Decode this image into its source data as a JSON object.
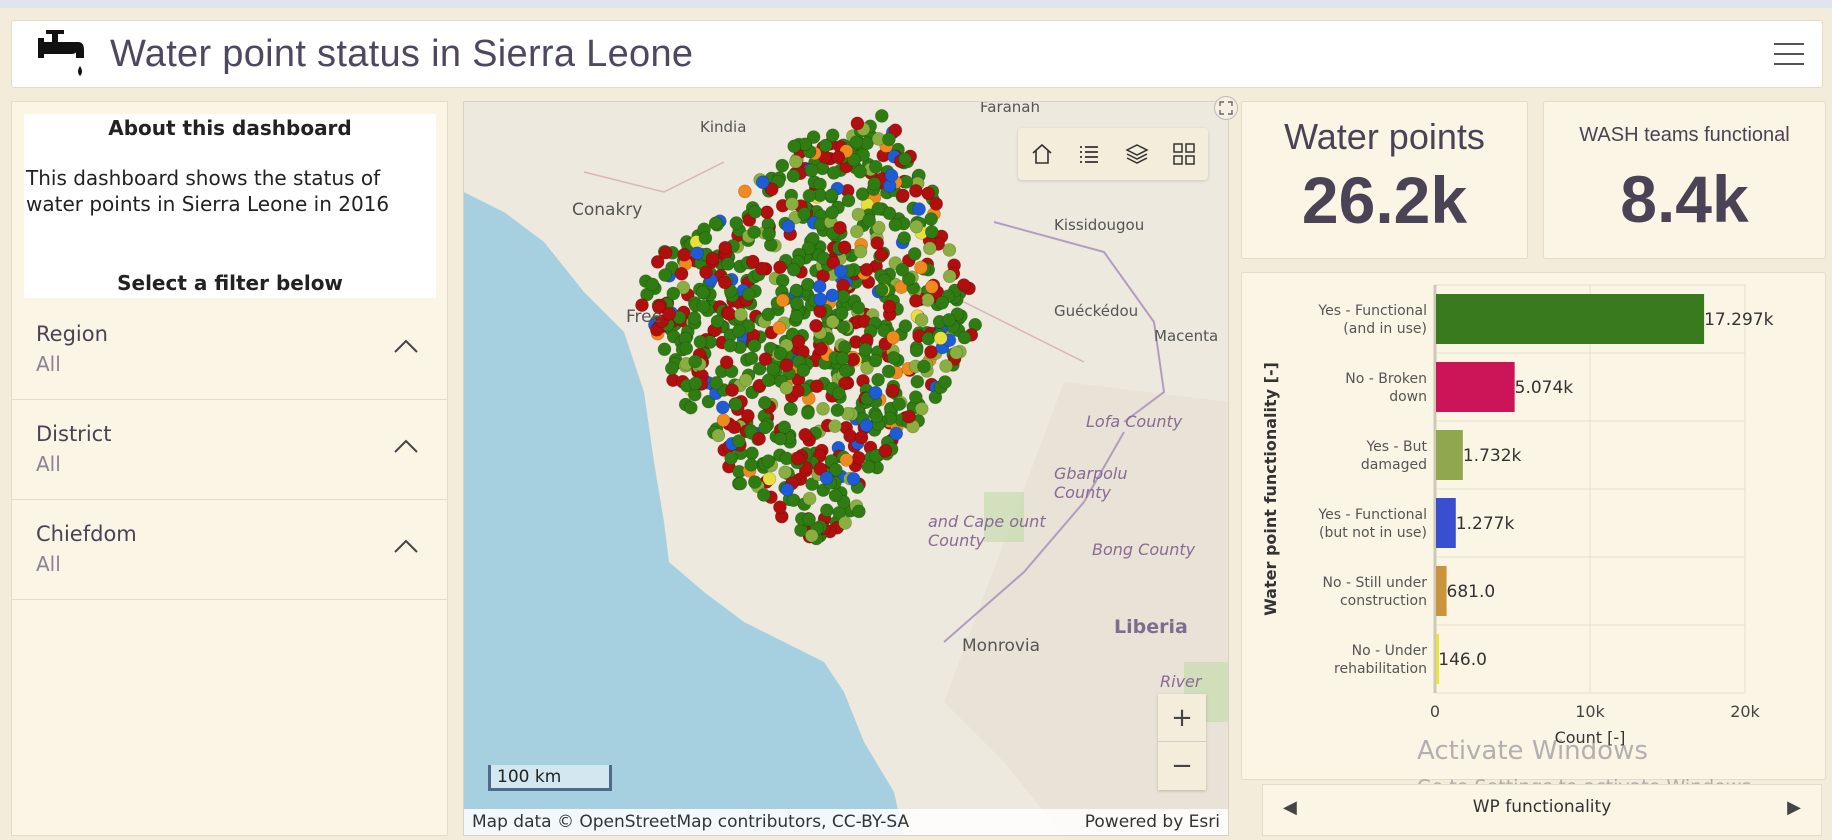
{
  "header": {
    "title": "Water point status in Sierra Leone"
  },
  "about": {
    "heading": "About this dashboard",
    "text": "This dashboard shows the status of water points in Sierra Leone in 2016",
    "filter_prompt": "Select a filter below"
  },
  "filters": [
    {
      "label": "Region",
      "value": "All"
    },
    {
      "label": "District",
      "value": "All"
    },
    {
      "label": "Chiefdom",
      "value": "All"
    }
  ],
  "map": {
    "labels": {
      "kindia": "Kindia",
      "faranah": "Faranah",
      "conakry": "Conakry",
      "kissidougou": "Kissidougou",
      "freetown": "Free",
      "gueckedou": "Guéckédou",
      "macenta": "Macenta",
      "lofa": "Lofa County",
      "gbarpolu": "Gbarpolu County",
      "grandcape": "and Cape ount County",
      "bong": "Bong County",
      "monrovia": "Monrovia",
      "liberia": "Liberia",
      "rivercess": "River Cess"
    },
    "scale_label": "100 km",
    "attribution": "Map data © OpenStreetMap contributors, CC-BY-SA",
    "powered_by": "Powered by Esri",
    "zoom_in": "+",
    "zoom_out": "−",
    "point_colors": [
      "#2f7d12",
      "#b10e0e",
      "#8aae3f",
      "#1e5bd6",
      "#f08a1c",
      "#e8e03a"
    ]
  },
  "kpis": {
    "water_points": {
      "title": "Water points",
      "value": "26.2k"
    },
    "wash_teams": {
      "title": "WASH teams functional",
      "value": "8.4k"
    }
  },
  "chart_data": {
    "type": "bar",
    "orientation": "horizontal",
    "categories": [
      [
        "Yes - Functional",
        "(and in use)"
      ],
      [
        "No - Broken",
        "down"
      ],
      [
        "Yes - But",
        "damaged"
      ],
      [
        "Yes - Functional",
        "(but not in use)"
      ],
      [
        "No - Still under",
        "construction"
      ],
      [
        "No - Under",
        "rehabilitation"
      ]
    ],
    "values": [
      17297,
      5074,
      1732,
      1277,
      681,
      146
    ],
    "value_labels": [
      "17.297k",
      "5.074k",
      "1.732k",
      "1.277k",
      "681.0",
      "146.0"
    ],
    "colors": [
      "#3a7a1e",
      "#cc1559",
      "#8fa84e",
      "#3a4fd0",
      "#c9943c",
      "#e8e43a"
    ],
    "xlim": [
      0,
      20000
    ],
    "xticks": [
      "0",
      "10k",
      "20k"
    ],
    "xlabel": "Count [-]",
    "ylabel": "Water point functionality [-]",
    "grid": true
  },
  "nav": {
    "label": "WP functionality",
    "prev": "◀",
    "next": "▶"
  },
  "watermark": {
    "line1": "Activate Windows",
    "line2": "Go to Settings to activate Windows."
  }
}
